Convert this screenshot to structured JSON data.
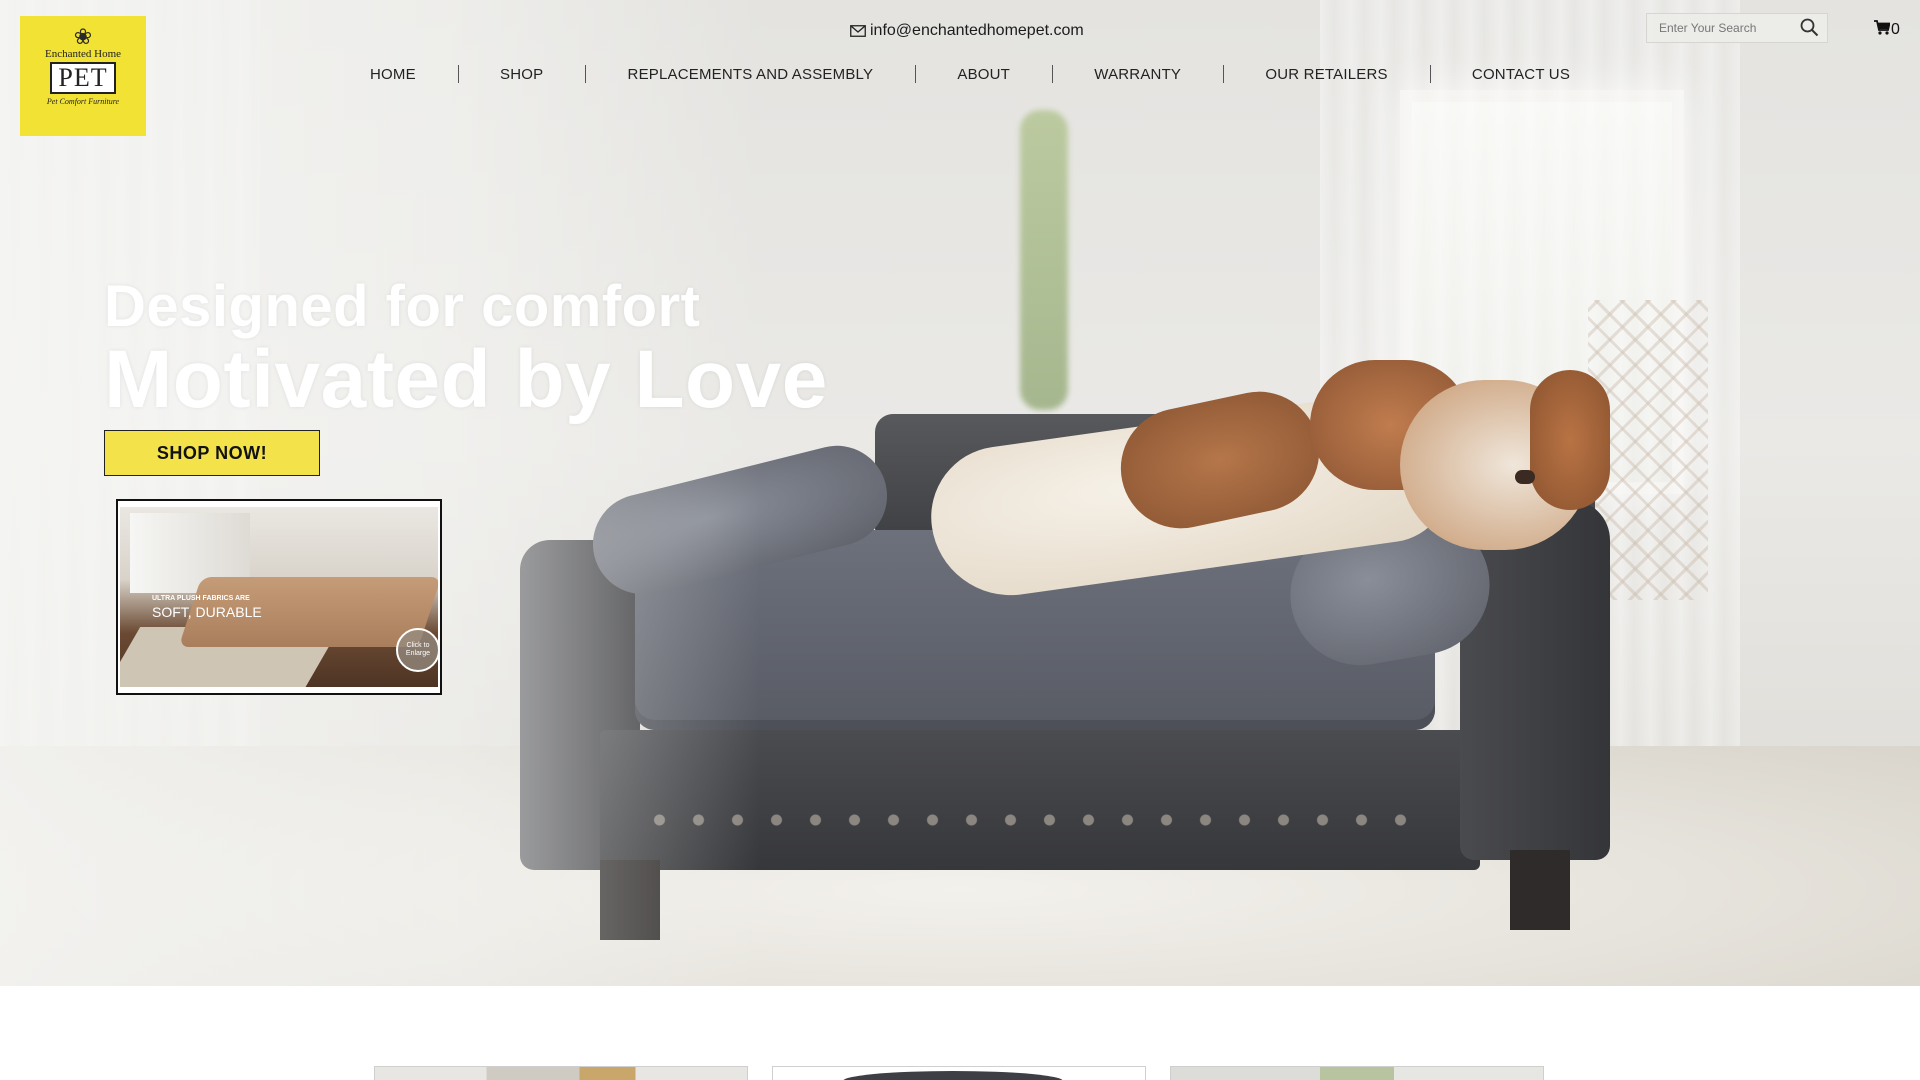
{
  "header": {
    "logo": {
      "line1": "Enchanted Home",
      "brand": "PET",
      "tagline": "Pet Comfort Furniture"
    },
    "email": "info@enchantedhomepet.com",
    "nav": [
      {
        "label": "HOME"
      },
      {
        "label": "SHOP"
      },
      {
        "label": "REPLACEMENTS AND ASSEMBLY"
      },
      {
        "label": "ABOUT"
      },
      {
        "label": "WARRANTY"
      },
      {
        "label": "OUR RETAILERS"
      },
      {
        "label": "CONTACT US"
      }
    ],
    "search": {
      "placeholder": "Enter Your Search",
      "value": ""
    },
    "cart": {
      "count": "0"
    }
  },
  "hero": {
    "headline1": "Designed for comfort",
    "headline2": "Motivated by Love",
    "cta_label": "SHOP NOW!",
    "video": {
      "caption1": "ULTRA PLUSH FABRICS ARE",
      "caption2": "SOFT, DURABLE",
      "enlarge_label": "Click to Enlarge"
    }
  },
  "colors": {
    "brand_yellow": "#f2e234",
    "cta_yellow": "#f3e24a",
    "text_dark": "#222222",
    "headline": "#ffffff"
  },
  "icons": [
    "envelope-icon",
    "search-icon",
    "cart-icon",
    "lotus-icon"
  ]
}
